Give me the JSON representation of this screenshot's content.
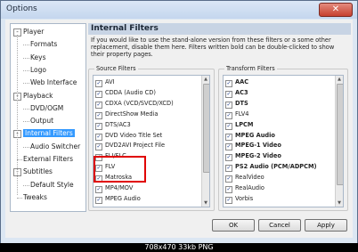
{
  "window": {
    "title": "Options",
    "close_glyph": "✕"
  },
  "tree": {
    "nodes": [
      {
        "label": "Player",
        "exp": "-"
      },
      {
        "label": "Formats"
      },
      {
        "label": "Keys"
      },
      {
        "label": "Logo"
      },
      {
        "label": "Web Interface"
      },
      {
        "label": "Playback",
        "exp": "-"
      },
      {
        "label": "DVD/OGM"
      },
      {
        "label": "Output"
      },
      {
        "label": "Internal Filters",
        "exp": "-",
        "selected": true
      },
      {
        "label": "Audio Switcher"
      },
      {
        "label": "External Filters"
      },
      {
        "label": "Subtitles",
        "exp": "-"
      },
      {
        "label": "Default Style"
      },
      {
        "label": "Tweaks"
      }
    ]
  },
  "panel": {
    "heading": "Internal Filters",
    "description": "If you would like to use the stand-alone version from these filters or a some other replacement, disable them here. Filters written bold can be double-clicked to show their property pages."
  },
  "source_filters": {
    "label": "Source Filters",
    "items": [
      {
        "label": "AVI",
        "checked": true
      },
      {
        "label": "CDDA (Audio CD)",
        "checked": true
      },
      {
        "label": "CDXA (VCD/SVCD/XCD)",
        "checked": true
      },
      {
        "label": "DirectShow Media",
        "checked": true
      },
      {
        "label": "DTS/AC3",
        "checked": true
      },
      {
        "label": "DVD Video Title Set",
        "checked": true
      },
      {
        "label": "DVD2AVI Project File",
        "checked": true
      },
      {
        "label": "FLI/FLC",
        "checked": true
      },
      {
        "label": "FLV",
        "checked": true
      },
      {
        "label": "Matroska",
        "checked": true
      },
      {
        "label": "MP4/MOV",
        "checked": true
      },
      {
        "label": "MPEG Audio",
        "checked": true
      }
    ]
  },
  "transform_filters": {
    "label": "Transform Filters",
    "items": [
      {
        "label": "AAC",
        "checked": true,
        "bold": true
      },
      {
        "label": "AC3",
        "checked": true,
        "bold": true
      },
      {
        "label": "DTS",
        "checked": true,
        "bold": true
      },
      {
        "label": "FLV4",
        "checked": true
      },
      {
        "label": "LPCM",
        "checked": true,
        "bold": true
      },
      {
        "label": "MPEG Audio",
        "checked": true,
        "bold": true
      },
      {
        "label": "MPEG-1 Video",
        "checked": true,
        "bold": true
      },
      {
        "label": "MPEG-2 Video",
        "checked": true,
        "bold": true
      },
      {
        "label": "PS2 Audio (PCM/ADPCM)",
        "checked": true,
        "bold": true
      },
      {
        "label": "RealVideo",
        "checked": true
      },
      {
        "label": "RealAudio",
        "checked": true
      },
      {
        "label": "Vorbis",
        "checked": true
      }
    ]
  },
  "buttons": {
    "ok": "OK",
    "cancel": "Cancel",
    "apply": "Apply"
  },
  "caption": "708x470 33kb PNG",
  "colors": {
    "selection": "#3399ff",
    "highlight_box": "#e00000"
  }
}
